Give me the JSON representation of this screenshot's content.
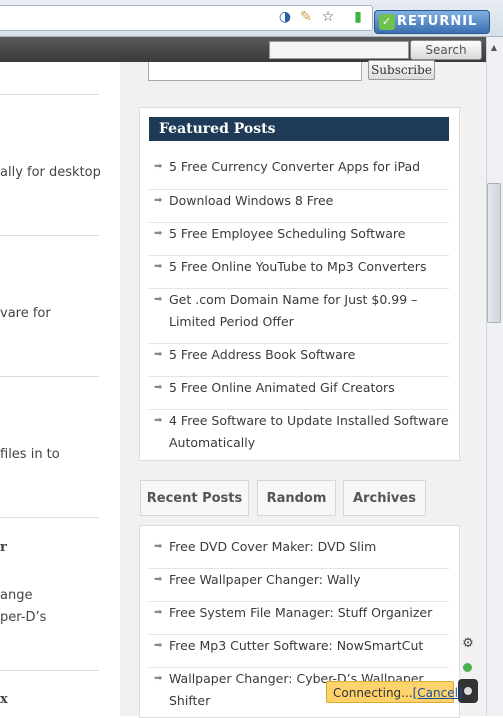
{
  "browser": {
    "returnil_label": "RETURNIL"
  },
  "header": {
    "search_button": "Search"
  },
  "subscribe": {
    "button": "Subscribe"
  },
  "left_column": {
    "snippets": [
      "ally for desktop",
      "vare for",
      "files in to",
      "r",
      "ange",
      "per-D’s",
      "x"
    ]
  },
  "featured": {
    "title": "Featured Posts",
    "posts": [
      "5 Free Currency Converter Apps for iPad",
      "Download Windows 8 Free",
      "5 Free Employee Scheduling Software",
      "5 Free Online YouTube to Mp3 Converters",
      "Get .com Domain Name for Just $0.99 – Limited Period Offer",
      "5 Free Address Book Software",
      "5 Free Online Animated Gif Creators",
      "4 Free Software to Update Installed Software Automatically"
    ]
  },
  "tabs": [
    "Recent Posts",
    "Random",
    "Archives"
  ],
  "recent": {
    "posts": [
      "Free DVD Cover Maker: DVD Slim",
      "Free Wallpaper Changer: Wally",
      "Free System File Manager: Stuff Organizer",
      "Free Mp3 Cutter Software: NowSmartCut",
      "Wallpaper Changer: Cyber-D’s Wallpaper Shifter"
    ]
  },
  "status": {
    "connecting": "Connecting...",
    "cancel": "[Cancel]"
  },
  "colors": {
    "featured_header": "#1e3a56",
    "site_header": "#3a3a3a",
    "notification": "#ffd36b"
  }
}
